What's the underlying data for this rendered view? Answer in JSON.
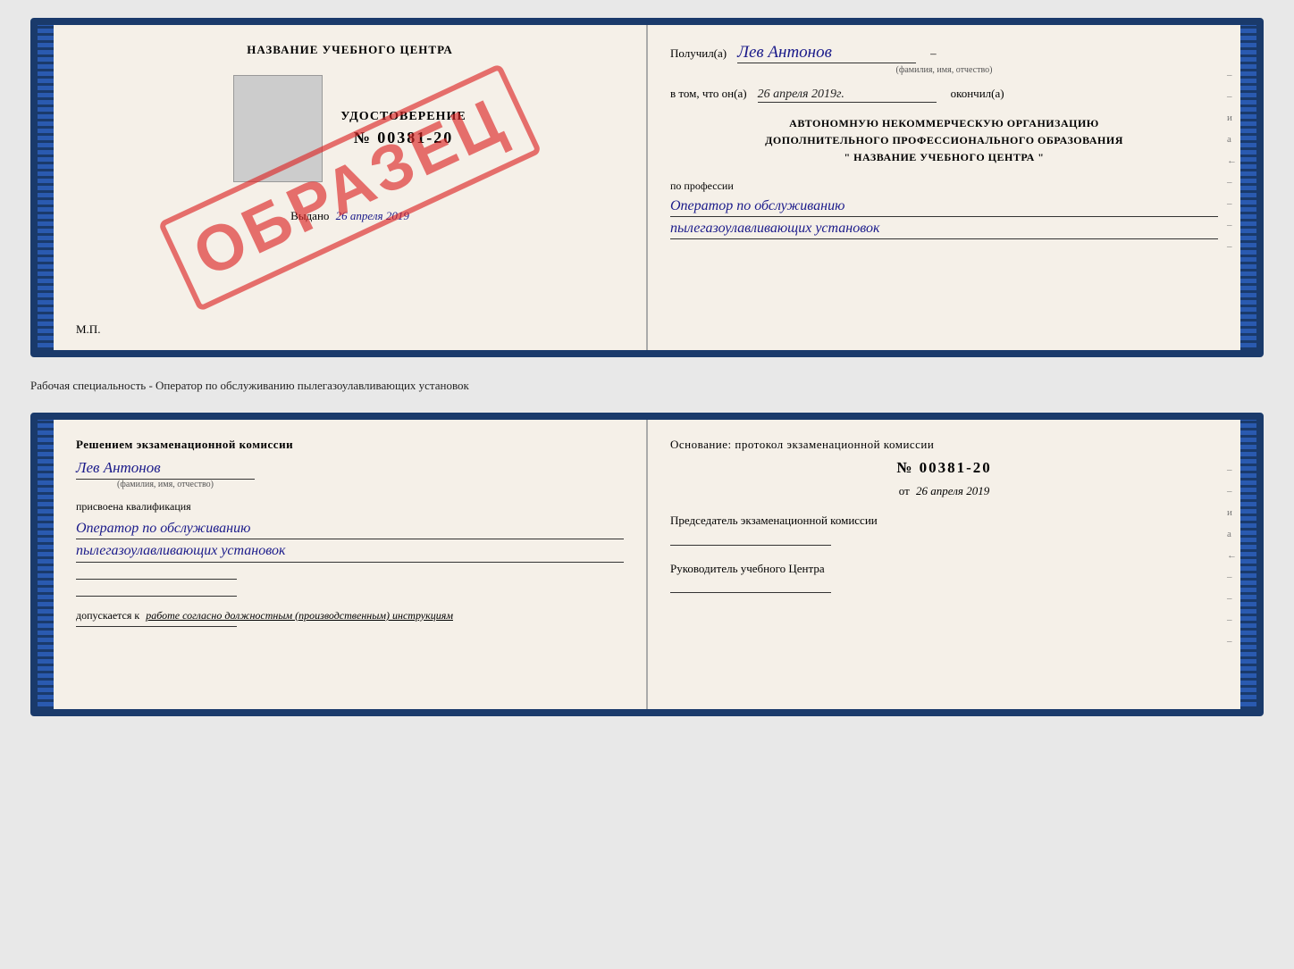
{
  "top_cert": {
    "left": {
      "title": "НАЗВАНИЕ УЧЕБНОГО ЦЕНТРА",
      "udostoverenie": "УДОСТОВЕРЕНИЕ",
      "number": "№ 00381-20",
      "stamp": "ОБРАЗЕЦ",
      "vydano_label": "Выдано",
      "vydano_date": "26 апреля 2019",
      "mp": "М.П."
    },
    "right": {
      "poluchil_label": "Получил(а)",
      "poluchil_value": "Лев Антонов",
      "fio_sublabel": "(фамилия, имя, отчество)",
      "vtom_label": "в том, что он(а)",
      "vtom_date": "26 апреля 2019г.",
      "okonchil": "окончил(а)",
      "org_line1": "АВТОНОМНУЮ НЕКОММЕРЧЕСКУЮ ОРГАНИЗАЦИЮ",
      "org_line2": "ДОПОЛНИТЕЛЬНОГО ПРОФЕССИОНАЛЬНОГО ОБРАЗОВАНИЯ",
      "org_line3": "\"  НАЗВАНИЕ УЧЕБНОГО ЦЕНТРА  \"",
      "profession_label": "по профессии",
      "profession_line1": "Оператор по обслуживанию",
      "profession_line2": "пылегазоулавливающих установок"
    }
  },
  "middle_text": "Рабочая специальность - Оператор по обслуживанию пылегазоулавливающих установок",
  "bottom_cert": {
    "left": {
      "decision_text": "Решением экзаменационной комиссии",
      "person_name": "Лев Антонов",
      "fio_sublabel": "(фамилия, имя, отчество)",
      "kvalifikacia_label": "присвоена квалификация",
      "profession_line1": "Оператор по обслуживанию",
      "profession_line2": "пылегазоулавливающих установок",
      "dopuskaetsya_label": "допускается к",
      "dopuskaetsya_value": "работе согласно должностным (производственным) инструкциям"
    },
    "right": {
      "osnovanie_label": "Основание: протокол экзаменационной комиссии",
      "number": "№  00381-20",
      "ot_label": "от",
      "ot_date": "26 апреля 2019",
      "chairman_label": "Председатель экзаменационной комиссии",
      "rukovoditel_label": "Руководитель учебного Центра"
    },
    "side_marks": [
      "и",
      "а",
      "←",
      "–",
      "–",
      "–",
      "–"
    ]
  }
}
